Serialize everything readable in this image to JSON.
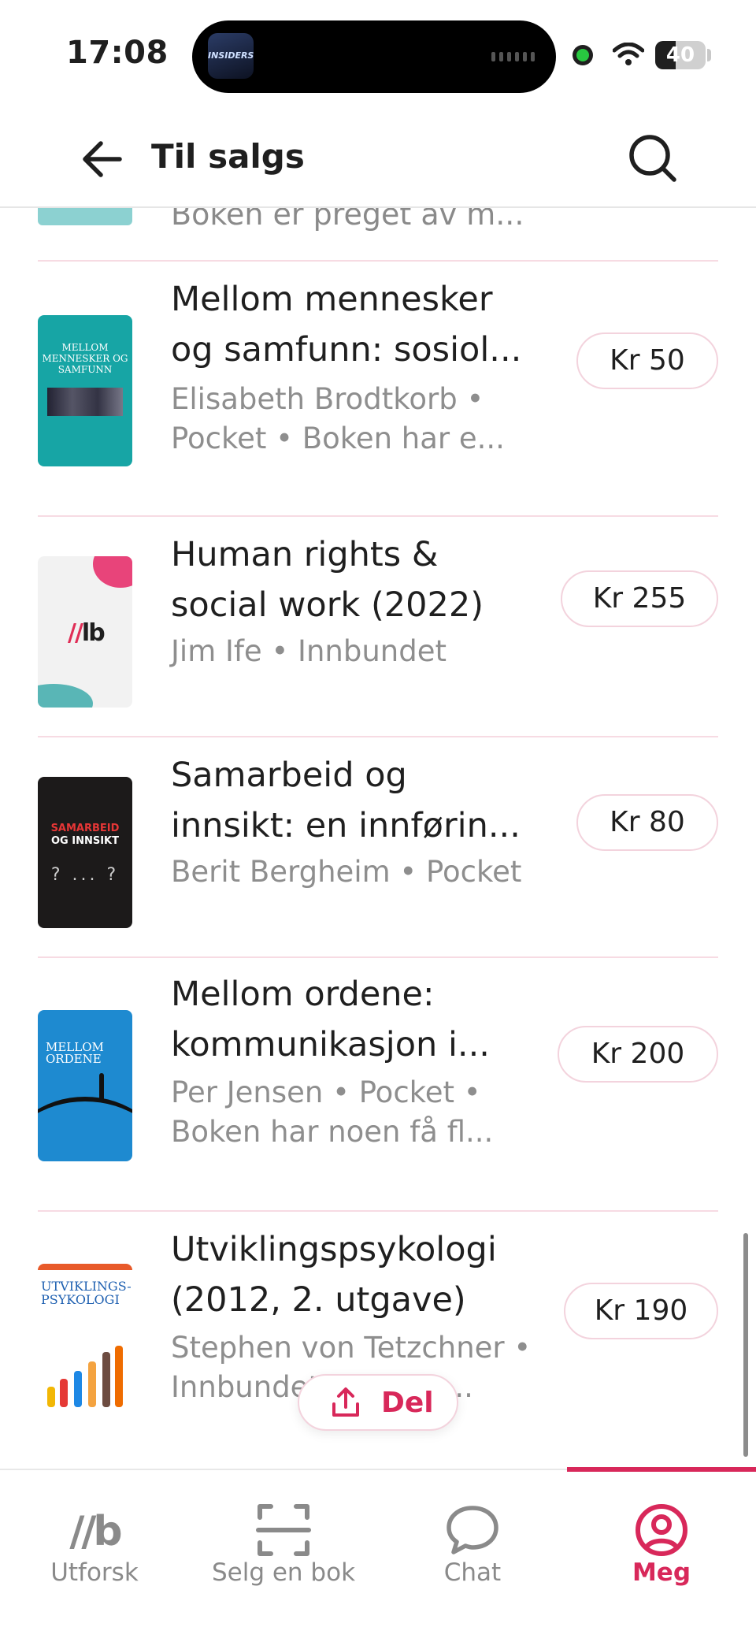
{
  "status_bar": {
    "time": "17:08",
    "battery": "40",
    "battery_level": 0.4,
    "island_app_label": "INSIDERS"
  },
  "header": {
    "title": "Til salgs"
  },
  "list": {
    "partial_item_meta": "Boken er preget av m...",
    "items": [
      {
        "title": "Mellom mennesker og samfunn: sosiol...",
        "meta": "Elisabeth Brodtkorb • Pocket • Boken har e...",
        "price": "Kr 50",
        "cover_text": "MELLOM MENNESKER OG SAMFUNN"
      },
      {
        "title": "Human rights & social work (2022)",
        "meta": "Jim Ife • Innbundet",
        "price": "Kr 255",
        "cover_text": "lb"
      },
      {
        "title": "Samarbeid og innsikt: en innførin...",
        "meta": "Berit Bergheim • Pocket",
        "price": "Kr 80",
        "cover_text_1": "SAMARBEID",
        "cover_text_2": "OG INNSIKT",
        "cover_marks": "? ... ?"
      },
      {
        "title": "Mellom ordene: kommunikasjon i...",
        "meta": "Per Jensen • Pocket • Boken har noen få fl...",
        "price": "Kr 200",
        "cover_text": "MELLOM ORDENE"
      },
      {
        "title": "Utviklingspsykologi (2012, 2. utgave)",
        "meta": "Stephen von Tetzchner • Innbundet • Boken...",
        "price": "Kr 190",
        "cover_text": "UTVIKLINGS-PSYKOLOGI"
      }
    ]
  },
  "share": {
    "label": "Del"
  },
  "tab_bar": {
    "tabs": [
      {
        "label": "Utforsk",
        "icon": "lb-logo-icon"
      },
      {
        "label": "Selg en bok",
        "icon": "scan-icon"
      },
      {
        "label": "Chat",
        "icon": "chat-bubble-icon"
      },
      {
        "label": "Meg",
        "icon": "profile-icon"
      }
    ],
    "active_index": 3
  },
  "colors": {
    "accent": "#d8285a",
    "divider": "#f7dbe3",
    "muted_text": "#8e8e8e"
  }
}
